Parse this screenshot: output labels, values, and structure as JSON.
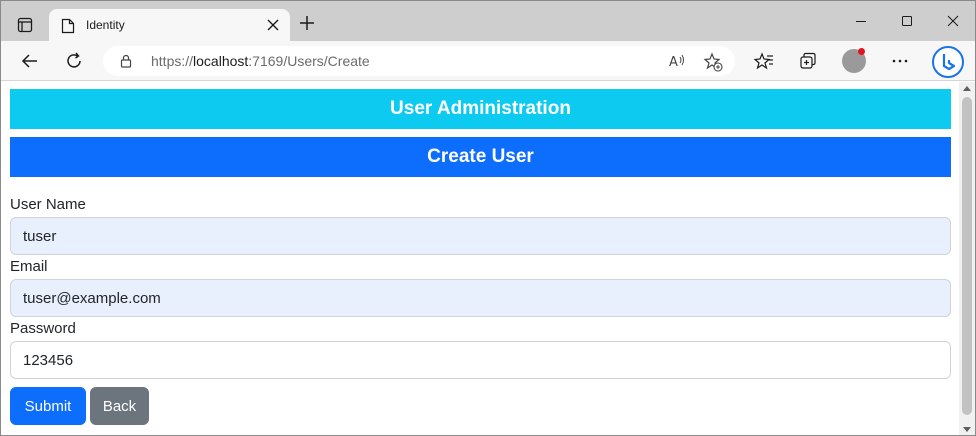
{
  "browser": {
    "tab_title": "Identity",
    "url_prefix": "https://",
    "url_host": "localhost",
    "url_rest": ":7169/Users/Create"
  },
  "page": {
    "admin_banner": "User Administration",
    "create_banner": "Create User"
  },
  "form": {
    "username_label": "User Name",
    "username_value": "tuser",
    "email_label": "Email",
    "email_value": "tuser@example.com",
    "password_label": "Password",
    "password_value": "123456",
    "submit_label": "Submit",
    "back_label": "Back"
  },
  "colors": {
    "info": "#0dcaf0",
    "primary": "#0d6efd",
    "secondary": "#6c757d",
    "autofill": "#e8f0fe"
  },
  "icons": [
    "tab-actions-icon",
    "page-icon",
    "close-icon",
    "plus-icon",
    "minimize-icon",
    "maximize-icon",
    "back-arrow-icon",
    "refresh-icon",
    "lock-icon",
    "read-aloud-icon",
    "add-favorite-icon",
    "favorites-icon",
    "collections-icon",
    "profile-icon",
    "more-icon",
    "bing-icon"
  ]
}
